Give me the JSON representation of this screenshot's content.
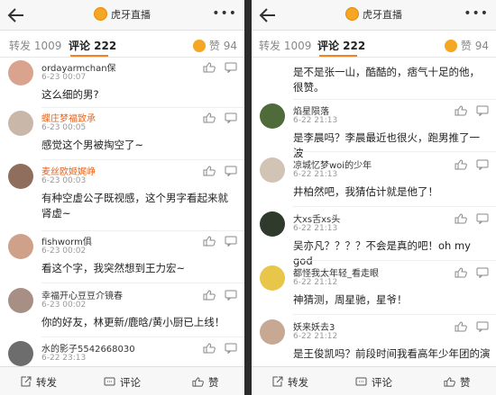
{
  "app": {
    "account_name": "虎牙直播"
  },
  "tabs": {
    "repost": "转发 1009",
    "comments": "评论 222",
    "likes": "赞 94"
  },
  "bottom_bar": {
    "repost": "转发",
    "comment": "评论",
    "like": "赞"
  },
  "colors": {
    "accent": "#f58220",
    "username_orange": "#e8641a"
  },
  "left_comments": [
    {
      "user": "ordayarmchan保",
      "time": "6-23 00:07",
      "text": "这么细的男?"
    },
    {
      "user": "蝶庄梦福致承",
      "time": "6-23 00:05",
      "text": "感觉这个男被掏空了~"
    },
    {
      "user": "麦丝欧姬娓峥",
      "time": "6-23 00:03",
      "text": "有种空虚公子既视感，这个男字看起来就肾虚~"
    },
    {
      "user": "fishworm俱",
      "time": "6-23 00:02",
      "text": "看这个字，我突然想到王力宏~"
    },
    {
      "user": "幸福开心豆豆介镜春",
      "time": "6-23 00:02",
      "text": "你的好友，林更新/鹿晗/黄小厨已上线！"
    },
    {
      "user": "水的影子5542668030",
      "time": "6-22 23:13",
      "text": ""
    }
  ],
  "right_comments": [
    {
      "user": "",
      "time": "",
      "text": "是不是张一山，酷酷的，痞气十足的他，很赞。"
    },
    {
      "user": "焰星陨落",
      "time": "6-22 21:13",
      "text": "是李晨吗？李晨最近也很火，跑男推了一波"
    },
    {
      "user": "凉城忆梦woi的少年",
      "time": "6-22 21:13",
      "text": "井柏然吧，我猜估计就是他了！"
    },
    {
      "user": "大xs舌xs头",
      "time": "6-22 21:13",
      "text": "吴亦凡？？？？不会是真的吧！oh my god"
    },
    {
      "user": "都怪我太年轻_看走眼",
      "time": "6-22 21:12",
      "text": "神猜测，周星驰，星爷！"
    },
    {
      "user": "妖来妖去3",
      "time": "6-22 21:12",
      "text": "是王俊凯吗？前段时间我看高年少年团的演"
    }
  ]
}
